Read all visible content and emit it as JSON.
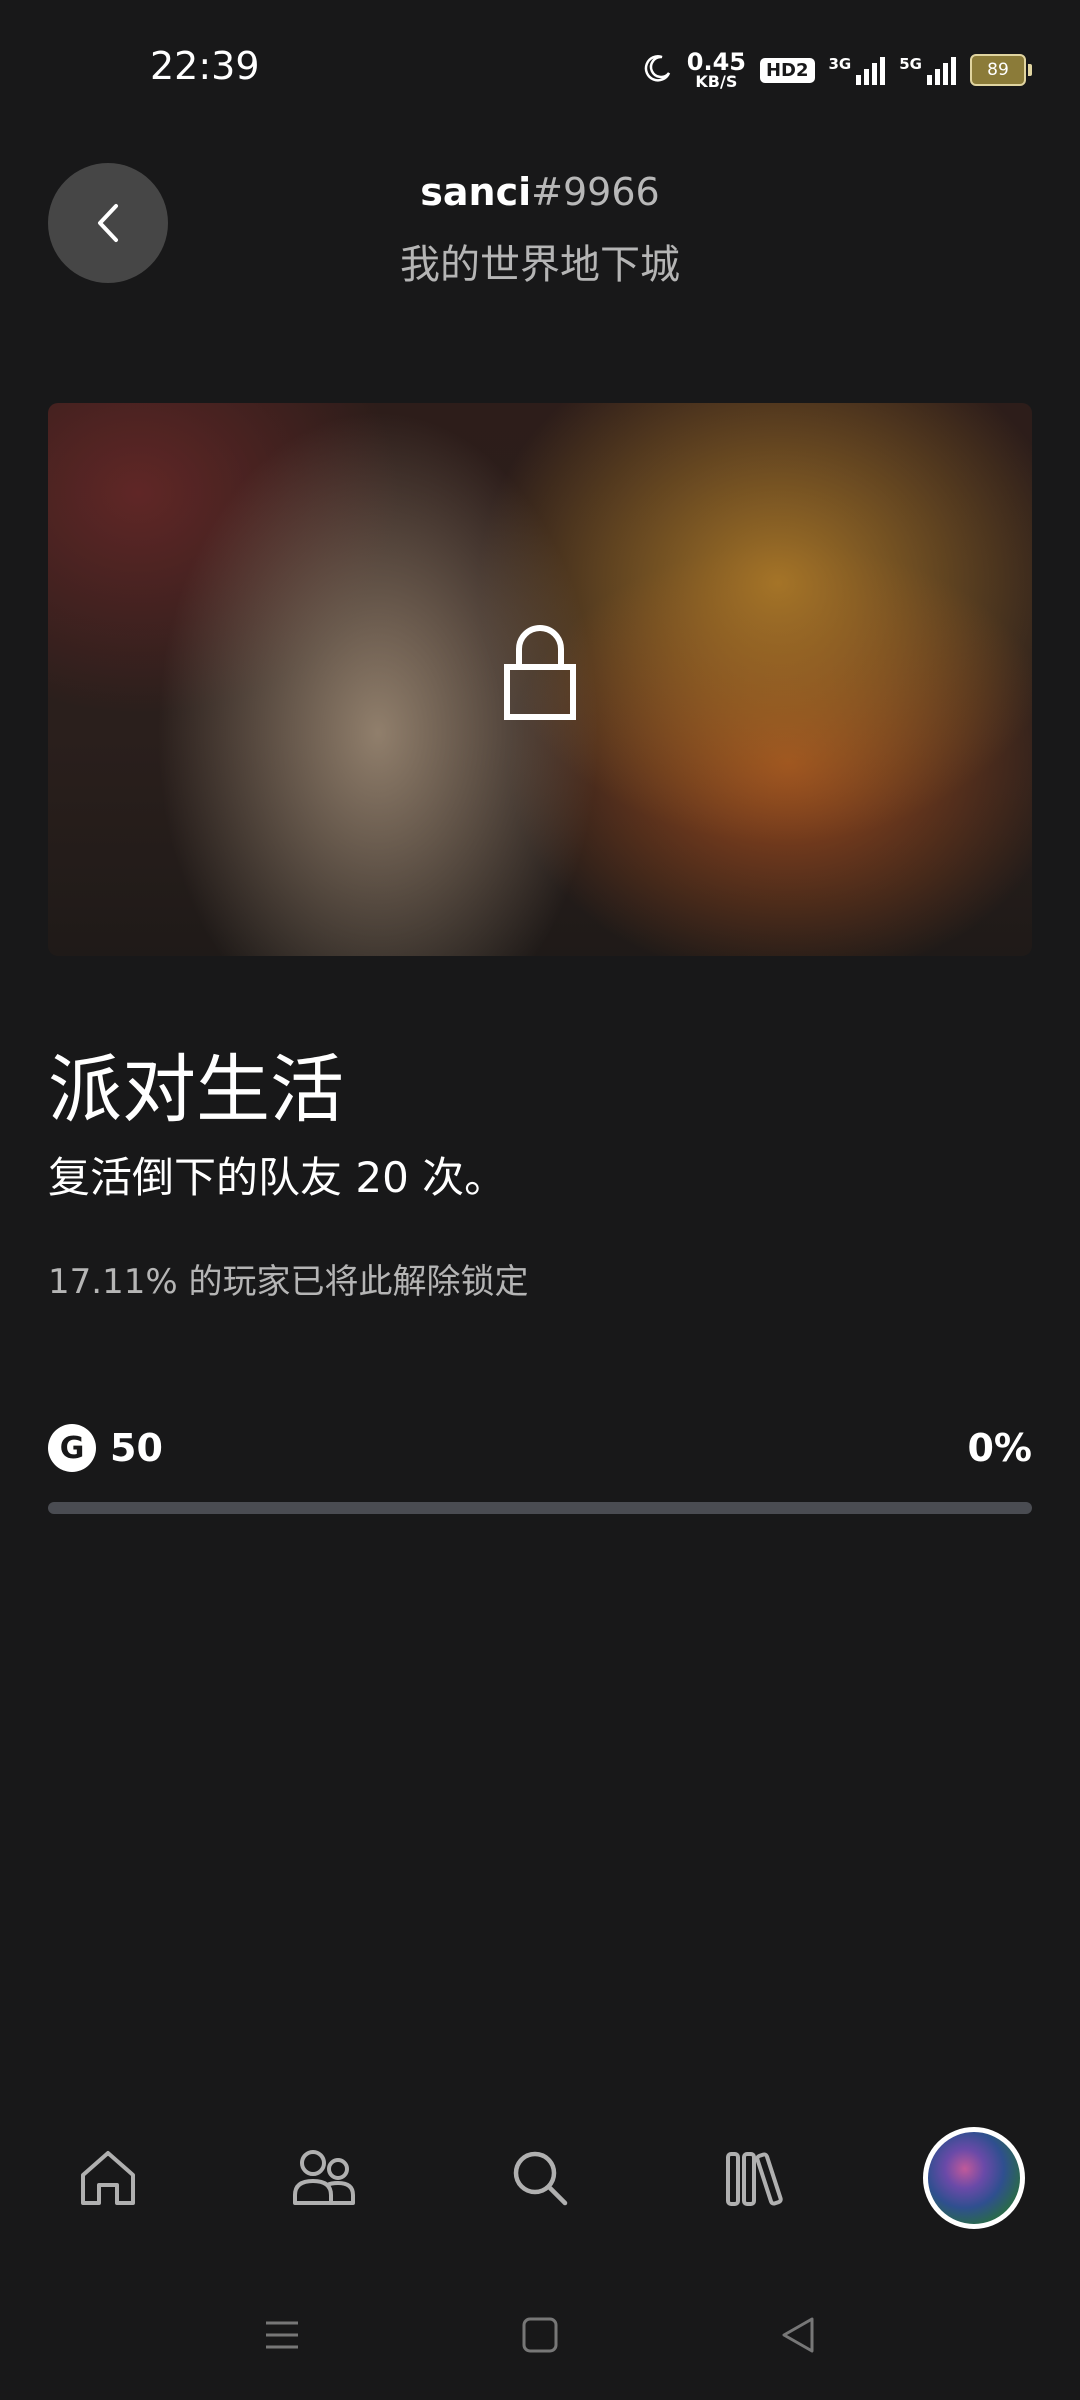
{
  "status_bar": {
    "time": "22:39",
    "net_speed_value": "0.45",
    "net_speed_unit": "KB/S",
    "hd_badge": "HD2",
    "signal1_label": "3G",
    "signal2_label": "5G",
    "battery": "89",
    "icons": [
      "moon-icon",
      "signal-icon",
      "battery-icon"
    ]
  },
  "header": {
    "username": "sanci",
    "user_tag": "#9966",
    "game_title": "我的世界地下城"
  },
  "achievement": {
    "locked": true,
    "title": "派对生活",
    "description": "复活倒下的队友 20 次。",
    "unlock_rate_text": "17.11% 的玩家已将此解除锁定",
    "gamerscore_badge": "G",
    "gamerscore": "50",
    "progress_text": "0%",
    "progress_fraction": 0
  },
  "bottom_nav": {
    "items": [
      "home-icon",
      "friends-icon",
      "search-icon",
      "library-icon",
      "profile-avatar"
    ]
  },
  "system_nav": {
    "items": [
      "menu-icon",
      "home-square-icon",
      "back-triangle-icon"
    ]
  },
  "colors": {
    "background": "#181819",
    "track": "#4a4c52",
    "secondary_text": "#b5b5b5"
  }
}
